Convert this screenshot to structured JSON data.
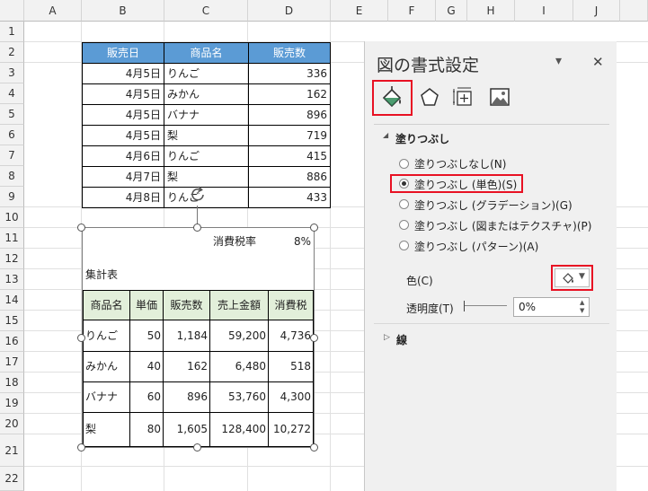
{
  "column_headers": [
    "A",
    "B",
    "C",
    "D",
    "E",
    "F",
    "G",
    "H",
    "I",
    "J"
  ],
  "row_headers": [
    "1",
    "2",
    "3",
    "4",
    "5",
    "6",
    "7",
    "8",
    "9",
    "10",
    "11",
    "12",
    "13",
    "14",
    "15",
    "16",
    "17",
    "18",
    "19",
    "20",
    "21",
    "22"
  ],
  "sales_table": {
    "headers": [
      "販売日",
      "商品名",
      "販売数"
    ],
    "rows": [
      [
        "4月5日",
        "りんご",
        "336"
      ],
      [
        "4月5日",
        "みかん",
        "162"
      ],
      [
        "4月5日",
        "バナナ",
        "896"
      ],
      [
        "4月5日",
        "梨",
        "719"
      ],
      [
        "4月6日",
        "りんご",
        "415"
      ],
      [
        "4月7日",
        "梨",
        "886"
      ],
      [
        "4月8日",
        "りんご",
        "433"
      ]
    ]
  },
  "picture": {
    "tax_label": "消費税率",
    "tax_rate": "8%",
    "summary_title": "集計表",
    "headers": [
      "商品名",
      "単価",
      "販売数",
      "売上金額",
      "消費税"
    ],
    "rows": [
      [
        "りんご",
        "50",
        "1,184",
        "59,200",
        "4,736"
      ],
      [
        "みかん",
        "40",
        "162",
        "6,480",
        "518"
      ],
      [
        "バナナ",
        "60",
        "896",
        "53,760",
        "4,300"
      ],
      [
        "梨",
        "80",
        "1,605",
        "128,400",
        "10,272"
      ]
    ]
  },
  "pane": {
    "title": "図の書式設定",
    "dropdown_glyph": "▾",
    "close_glyph": "✕",
    "fill_section": "塗りつぶし",
    "fill_options": [
      "塗りつぶしなし(N)",
      "塗りつぶし (単色)(S)",
      "塗りつぶし (グラデーション)(G)",
      "塗りつぶし (図またはテクスチャ)(P)",
      "塗りつぶし (パターン)(A)"
    ],
    "selected_fill_option": "塗りつぶし (単色)(S)",
    "color_label": "色(C)",
    "transparency_label": "透明度(T)",
    "transparency_value": "0%",
    "line_section": "線",
    "icons": [
      "fill-line-icon",
      "effects-pentagon-icon",
      "size-properties-icon",
      "picture-icon"
    ],
    "accent_color": "#e81123"
  }
}
